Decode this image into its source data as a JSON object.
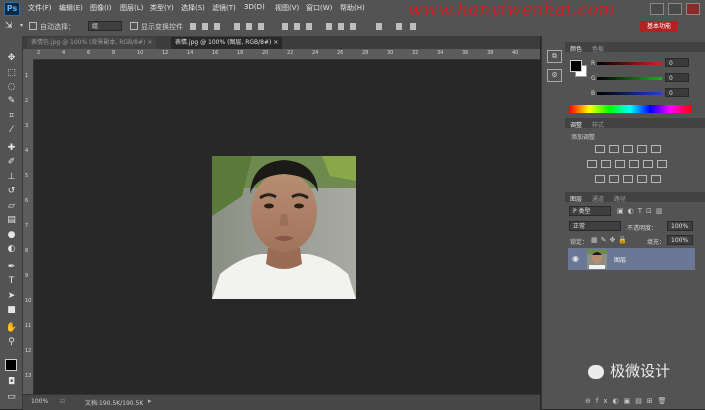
{
  "app": {
    "logo": "Ps"
  },
  "menu": [
    "文件(F)",
    "编辑(E)",
    "图像(I)",
    "图层(L)",
    "类型(Y)",
    "选择(S)",
    "滤镜(T)",
    "3D(D)",
    "视图(V)",
    "窗口(W)",
    "帮助(H)"
  ],
  "watermark": "www.hanyiwenhai.com",
  "options_bar": {
    "auto_select_label": "自动选择：",
    "auto_select_value": "组",
    "show_transform_label": "显示变换控件",
    "workspace_badge": "基本功能"
  },
  "document_tabs": [
    {
      "label": "表情包.jpg @ 100% (背景副本, RGB/8#) ×",
      "active": false
    },
    {
      "label": "表情.jpg @ 100% (图层, RGB/8#) ×",
      "active": true
    }
  ],
  "ruler_top": [
    "2",
    "4",
    "6",
    "8",
    "10",
    "12",
    "14",
    "16",
    "18",
    "20",
    "22",
    "24",
    "26",
    "28",
    "30",
    "32",
    "34",
    "36",
    "38",
    "40"
  ],
  "ruler_left": [
    "1",
    "2",
    "3",
    "4",
    "5",
    "6",
    "7",
    "8",
    "9",
    "10",
    "11",
    "12",
    "13"
  ],
  "status": {
    "zoom": "100%",
    "doc": "文档:190.5K/190.5K"
  },
  "color_panel": {
    "tabs": [
      "颜色",
      "色板"
    ],
    "channels": [
      {
        "label": "R",
        "value": "0",
        "color": "#d82020"
      },
      {
        "label": "G",
        "value": "0",
        "color": "#22b022"
      },
      {
        "label": "B",
        "value": "0",
        "color": "#2040d8"
      }
    ]
  },
  "adjustments_panel": {
    "tabs": [
      "调整",
      "样式"
    ],
    "title": "添加调整"
  },
  "layers_panel": {
    "tabs": [
      "图层",
      "通道",
      "路径"
    ],
    "filter_label": "P 类型",
    "blend_mode": "正常",
    "opacity_label": "不透明度：",
    "opacity_value": "100%",
    "lock_label": "锁定：",
    "fill_label": "填充：",
    "fill_value": "100%",
    "layer_name": "图层"
  },
  "wechat": {
    "text": "极微设计"
  }
}
